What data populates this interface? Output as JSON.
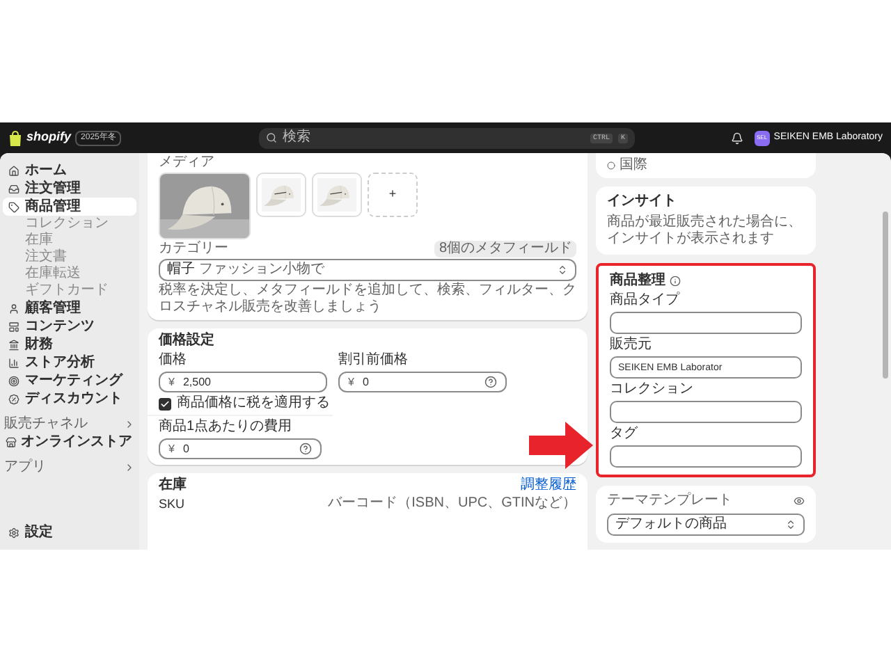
{
  "top_bar": {
    "logo": "shopify",
    "edition_badge": "2025年冬",
    "search": {
      "placeholder": "検索",
      "shortcut": [
        "CTRL",
        "K"
      ]
    },
    "store": {
      "avatar": "SEL",
      "name": "SEIKEN EMB Laboratory"
    }
  },
  "sidebar": {
    "items": [
      {
        "label": "ホーム",
        "selected": false
      },
      {
        "label": "注文管理",
        "selected": false
      },
      {
        "label": "商品管理",
        "selected": true,
        "children": [
          {
            "label": "コレクション",
            "selected": false
          },
          {
            "label": "在庫",
            "selected": false
          },
          {
            "label": "注文書",
            "selected": false
          },
          {
            "label": "在庫転送",
            "selected": false
          },
          {
            "label": "ギフトカード",
            "selected": false
          }
        ]
      },
      {
        "label": "顧客管理",
        "selected": false
      },
      {
        "label": "コンテンツ",
        "selected": false
      },
      {
        "label": "財務",
        "selected": false
      },
      {
        "label": "ストア分析",
        "selected": false
      },
      {
        "label": "マーケティング",
        "selected": false
      },
      {
        "label": "ディスカウント",
        "selected": false
      }
    ],
    "sections": [
      {
        "title": "販売チャネル",
        "items": [
          {
            "label": "オンラインストア",
            "selected": false
          }
        ]
      },
      {
        "title": "アプリ"
      }
    ],
    "settings": "設定"
  },
  "media": {
    "title": "メディア",
    "add_button": "+"
  },
  "category": {
    "label": "カテゴリー",
    "badge": "8個のメタフィールド",
    "value": "帽子",
    "path": "ファッション小物で",
    "hint": "税率を決定し、メタフィールドを追加して、検索、フィルター、クロスチャネル販売を改善しましょう"
  },
  "pricing": {
    "title": "価格設定",
    "price": {
      "label": "価格",
      "currency": "¥",
      "value": "2,500"
    },
    "compare_at": {
      "label": "割引前価格",
      "currency": "¥",
      "value": "0"
    },
    "tax": {
      "label": "商品価格に税を適用する",
      "checked": true
    },
    "cost": {
      "label": "商品1点あたりの費用",
      "currency": "¥",
      "value": "0"
    }
  },
  "inventory": {
    "title": "在庫",
    "link": "調整履歴",
    "sku_label": "SKU",
    "barcode_label": "バーコード（ISBN、UPC、GTINなど）"
  },
  "markets": {
    "item": "国際"
  },
  "insights": {
    "title": "インサイト",
    "text": "商品が最近販売された場合に、インサイトが表示されます"
  },
  "organization": {
    "title": "商品整理",
    "highlighted": true,
    "fields": [
      {
        "label": "商品タイプ"
      },
      {
        "label": "販売元",
        "value": "SEIKEN EMB Laborator"
      },
      {
        "label": "コレクション"
      },
      {
        "label": "タグ"
      }
    ]
  },
  "theme": {
    "label": "テーマテンプレート",
    "value": "デフォルトの商品"
  }
}
